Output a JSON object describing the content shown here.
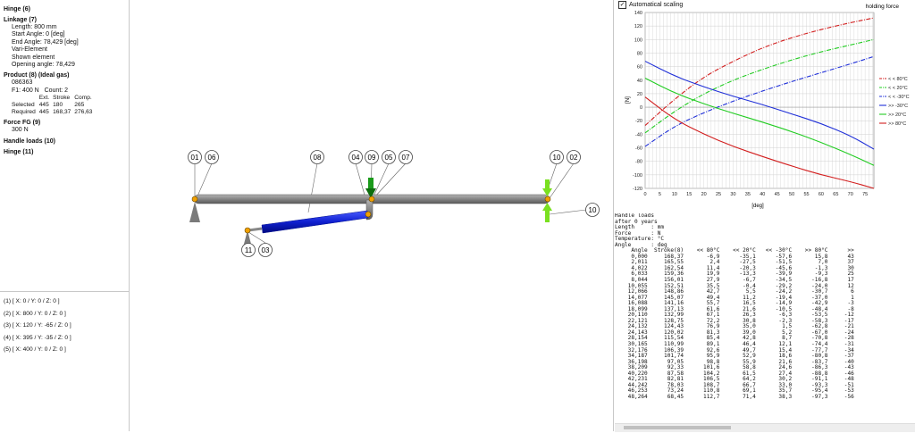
{
  "tree": {
    "hinge": "Hinge (6)",
    "linkage": "Linkage (7)",
    "linkage_items": [
      "Length: 800 mm",
      "Start Angle: 0 [deg]",
      "End Angle: 78,429 [deg]",
      "Vari-Element",
      "Shown element",
      "Opening angle: 78,429"
    ],
    "product": "Product (8) (Ideal gas)",
    "product_code": "086363",
    "product_force": "F1: 400 N",
    "product_count": "Count: 2",
    "product_table": {
      "headers": [
        "",
        "Ext.",
        "Stroke",
        "Comp."
      ],
      "rows": [
        [
          "Selected",
          "445",
          "180",
          "265"
        ],
        [
          "Required",
          "445",
          "168,37",
          "276,63"
        ]
      ]
    },
    "force": "Force FG (9)",
    "force_value": "300 N",
    "handle": "Handle loads (10)",
    "hinge2": "Hinge (11)"
  },
  "points": [
    "(1) [ X: 0 / Y: 0 / Z: 0 ]",
    "(2) [ X: 800 / Y: 0 / Z: 0 ]",
    "(3) [ X: 120 / Y: -65 / Z: 0 ]",
    "(4) [ X: 395 / Y: -35 / Z: 0 ]",
    "(5) [ X: 400 / Y: 0 / Z: 0 ]"
  ],
  "labels": [
    "01",
    "06",
    "08",
    "04",
    "09",
    "05",
    "07",
    "10",
    "02",
    "10",
    "11",
    "03"
  ],
  "chart": {
    "checkbox_label": "Automatical scaling",
    "checkbox_mark": "✓",
    "title": "holding force",
    "ylabel": "[N]",
    "xlabel": "[deg]",
    "colors": {
      "red": "#d21e1e",
      "green": "#22cc22",
      "blue": "#2030d8"
    },
    "legend": [
      "< < 80°C",
      "< < 20°C",
      "< < -30°C",
      ">> -30°C",
      ">> 20°C",
      ">> 80°C"
    ]
  },
  "chart_data": {
    "type": "line",
    "title": "holding force",
    "xlabel": "[deg]",
    "ylabel": "[N]",
    "xlim": [
      0,
      78
    ],
    "ylim": [
      -120,
      140
    ],
    "x_ticks": [
      0,
      5,
      10,
      15,
      20,
      25,
      30,
      35,
      40,
      45,
      50,
      55,
      60,
      65,
      70,
      75
    ],
    "y_ticks": [
      140,
      120,
      100,
      80,
      60,
      40,
      20,
      0,
      -20,
      -40,
      -60,
      -80,
      -100,
      -120
    ],
    "grid": true,
    "legend_position": "right",
    "series": [
      {
        "name": "< < 80°C",
        "style": "dashdot",
        "color": "#d21e1e",
        "x": [
          0,
          10,
          20,
          30,
          40,
          50,
          60,
          70,
          78
        ],
        "y": [
          -27,
          12,
          45,
          68,
          88,
          103,
          115,
          125,
          132
        ]
      },
      {
        "name": "< < 20°C",
        "style": "dashdot",
        "color": "#22cc22",
        "x": [
          0,
          10,
          20,
          30,
          40,
          50,
          60,
          70,
          78
        ],
        "y": [
          -38,
          -6,
          20,
          40,
          56,
          70,
          82,
          92,
          100
        ]
      },
      {
        "name": "< < -30°C",
        "style": "dashdot",
        "color": "#2030d8",
        "x": [
          0,
          10,
          20,
          30,
          40,
          50,
          60,
          70,
          78
        ],
        "y": [
          -58,
          -28,
          -8,
          9,
          24,
          38,
          51,
          64,
          75
        ]
      },
      {
        "name": ">> -30°C",
        "style": "solid",
        "color": "#2030d8",
        "x": [
          0,
          10,
          20,
          30,
          40,
          50,
          60,
          70,
          78
        ],
        "y": [
          68,
          46,
          30,
          16,
          4,
          -10,
          -24,
          -42,
          -62
        ]
      },
      {
        "name": ">> 20°C",
        "style": "solid",
        "color": "#22cc22",
        "x": [
          0,
          10,
          20,
          30,
          40,
          50,
          60,
          70,
          78
        ],
        "y": [
          43,
          21,
          5,
          -9,
          -22,
          -36,
          -52,
          -70,
          -86
        ]
      },
      {
        "name": ">> 80°C",
        "style": "solid",
        "color": "#d21e1e",
        "x": [
          0,
          10,
          20,
          30,
          40,
          50,
          60,
          70,
          78
        ],
        "y": [
          15,
          -18,
          -40,
          -58,
          -73,
          -87,
          -100,
          -110,
          -120
        ]
      }
    ]
  },
  "table": {
    "header_lines": [
      "Handle loads",
      "after 0 years",
      "Length     : mm",
      "Force      : N",
      "Temperature: °C",
      "Angle      : deg"
    ],
    "columns": [
      "Angle",
      "Stroke(8)",
      "<< 80°C",
      "<< 20°C",
      "<< -30°C",
      ">> 80°C",
      ">>"
    ],
    "rows": [
      [
        "0,000",
        "168,37",
        "-6,9",
        "-35,1",
        "-57,6",
        "15,8",
        "43"
      ],
      [
        "2,011",
        "165,55",
        "2,4",
        "-27,5",
        "-51,5",
        "7,0",
        "37"
      ],
      [
        "4,022",
        "162,54",
        "11,4",
        "-20,3",
        "-45,6",
        "-1,3",
        "30"
      ],
      [
        "6,033",
        "159,36",
        "19,9",
        "-13,3",
        "-39,9",
        "-9,3",
        "25"
      ],
      [
        "8,044",
        "156,01",
        "27,9",
        "-6,7",
        "-34,5",
        "-16,8",
        "17"
      ],
      [
        "10,055",
        "152,51",
        "35,5",
        "-0,4",
        "-29,2",
        "-24,0",
        "12"
      ],
      [
        "12,066",
        "148,86",
        "42,7",
        "5,5",
        "-24,2",
        "-30,7",
        "6"
      ],
      [
        "14,077",
        "145,07",
        "49,4",
        "11,2",
        "-19,4",
        "-37,0",
        "1"
      ],
      [
        "16,088",
        "141,16",
        "55,7",
        "16,5",
        "-14,9",
        "-42,9",
        "-3"
      ],
      [
        "18,099",
        "137,13",
        "61,6",
        "21,6",
        "-10,5",
        "-48,4",
        "-8"
      ],
      [
        "20,110",
        "132,99",
        "67,1",
        "26,3",
        "-6,3",
        "-53,5",
        "-12"
      ],
      [
        "22,121",
        "128,75",
        "72,2",
        "30,8",
        "-2,3",
        "-58,3",
        "-17"
      ],
      [
        "24,132",
        "124,43",
        "76,9",
        "35,0",
        "1,5",
        "-62,8",
        "-21"
      ],
      [
        "24,143",
        "120,02",
        "81,3",
        "39,0",
        "5,2",
        "-67,0",
        "-24"
      ],
      [
        "28,154",
        "115,54",
        "85,4",
        "42,8",
        "8,7",
        "-70,8",
        "-28"
      ],
      [
        "30,165",
        "110,99",
        "89,1",
        "46,4",
        "12,1",
        "-74,4",
        "-31"
      ],
      [
        "32,176",
        "106,39",
        "92,6",
        "49,7",
        "15,4",
        "-77,7",
        "-34"
      ],
      [
        "34,187",
        "101,74",
        "95,9",
        "52,9",
        "18,6",
        "-80,8",
        "-37"
      ],
      [
        "36,198",
        "97,05",
        "98,8",
        "55,9",
        "21,6",
        "-83,7",
        "-40"
      ],
      [
        "38,209",
        "92,33",
        "101,6",
        "58,8",
        "24,6",
        "-86,3",
        "-43"
      ],
      [
        "40,220",
        "87,58",
        "104,2",
        "61,5",
        "27,4",
        "-88,8",
        "-46"
      ],
      [
        "42,231",
        "82,81",
        "106,5",
        "64,2",
        "30,2",
        "-91,1",
        "-48"
      ],
      [
        "44,242",
        "78,03",
        "108,7",
        "66,7",
        "33,0",
        "-93,3",
        "-51"
      ],
      [
        "46,253",
        "73,24",
        "110,8",
        "69,1",
        "35,7",
        "-95,4",
        "-53"
      ],
      [
        "48,264",
        "68,45",
        "112,7",
        "71,4",
        "38,3",
        "-97,3",
        "-56"
      ]
    ]
  }
}
